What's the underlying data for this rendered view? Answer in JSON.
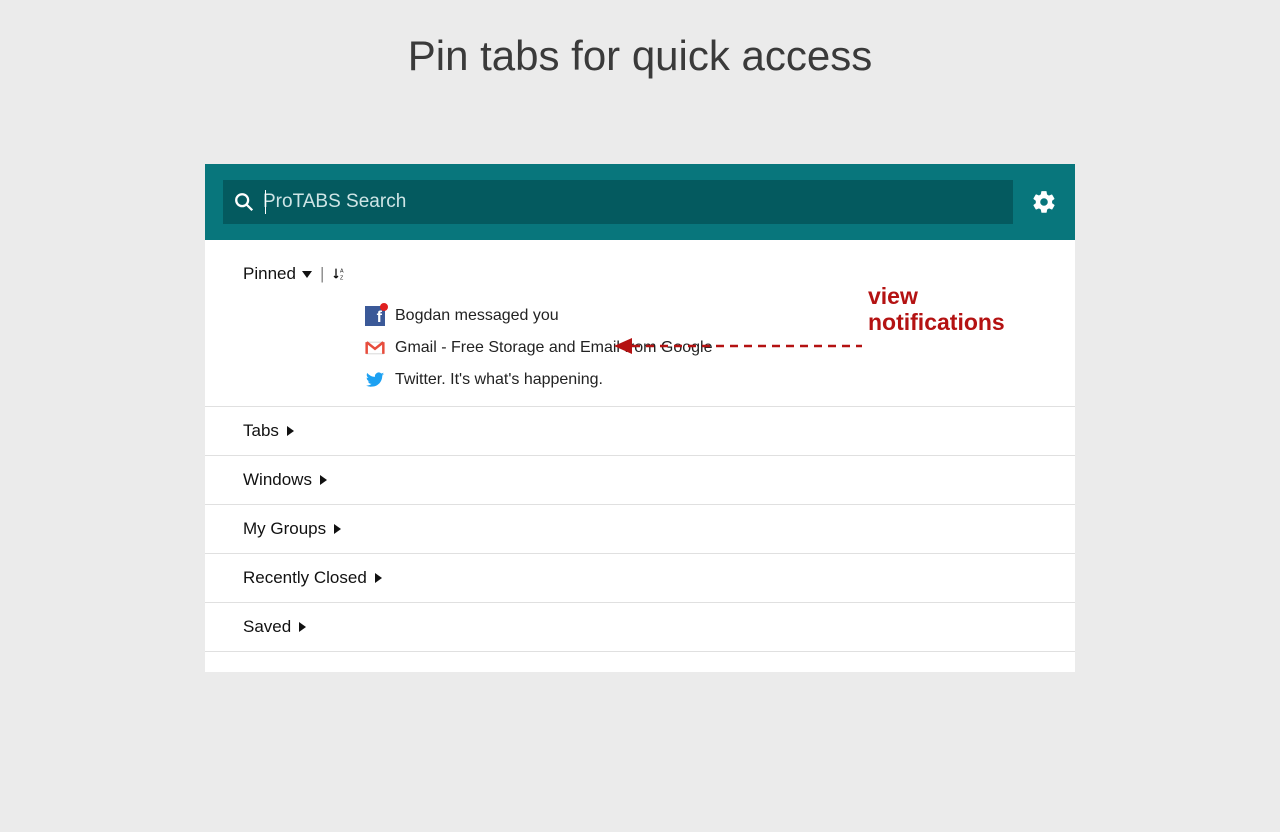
{
  "page_title": "Pin tabs for quick access",
  "search": {
    "placeholder": "ProTABS Search"
  },
  "sections": {
    "pinned_label": "Pinned",
    "tabs_label": "Tabs",
    "windows_label": "Windows",
    "my_groups_label": "My Groups",
    "recently_closed_label": "Recently Closed",
    "saved_label": "Saved"
  },
  "pinned_items": [
    {
      "title": "Bogdan messaged you",
      "icon": "facebook",
      "has_notification": true
    },
    {
      "title": "Gmail - Free Storage and Email from Google",
      "icon": "gmail",
      "has_notification": false
    },
    {
      "title": "Twitter. It's what's happening.",
      "icon": "twitter",
      "has_notification": false
    }
  ],
  "annotation": {
    "line1": "view",
    "line2": "notifications"
  }
}
